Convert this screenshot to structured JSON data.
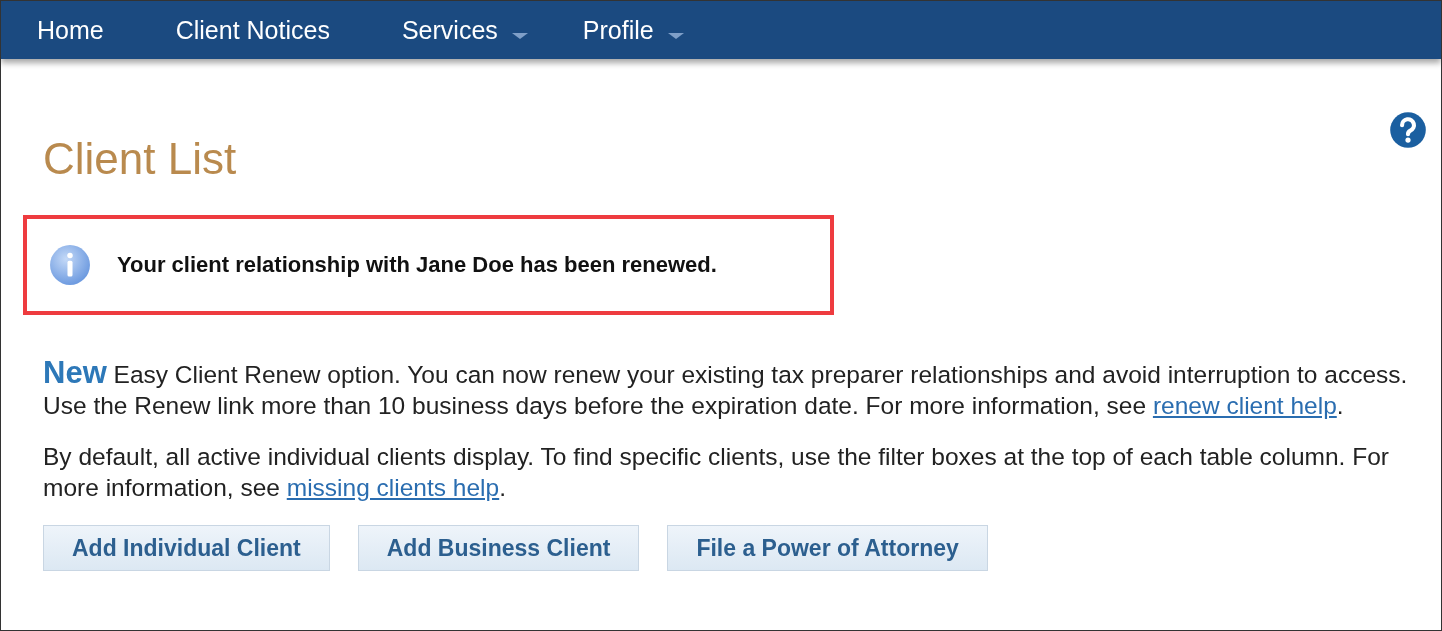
{
  "nav": {
    "items": [
      {
        "label": "Home",
        "has_menu": false
      },
      {
        "label": "Client Notices",
        "has_menu": false
      },
      {
        "label": "Services",
        "has_menu": true
      },
      {
        "label": "Profile",
        "has_menu": true
      }
    ]
  },
  "page": {
    "title": "Client List"
  },
  "alert": {
    "message": "Your client relationship with Jane Doe has been renewed."
  },
  "paragraphs": [
    {
      "segments": [
        {
          "kind": "lead",
          "text": "New"
        },
        {
          "kind": "text",
          "text": " Easy Client Renew option. You can now renew your existing tax preparer relationships and avoid interruption to access. Use the Renew link more than 10 business days before the expiration date. For more information, see "
        },
        {
          "kind": "link",
          "text": "renew client help"
        },
        {
          "kind": "text",
          "text": "."
        }
      ]
    },
    {
      "segments": [
        {
          "kind": "text",
          "text": "By default, all active individual clients display. To find specific clients, use the filter boxes at the top of each table column. For more information, see "
        },
        {
          "kind": "link",
          "text": "missing clients help"
        },
        {
          "kind": "text",
          "text": "."
        }
      ]
    }
  ],
  "buttons": [
    "Add Individual Client",
    "Add Business Client",
    "File a Power of Attorney"
  ]
}
